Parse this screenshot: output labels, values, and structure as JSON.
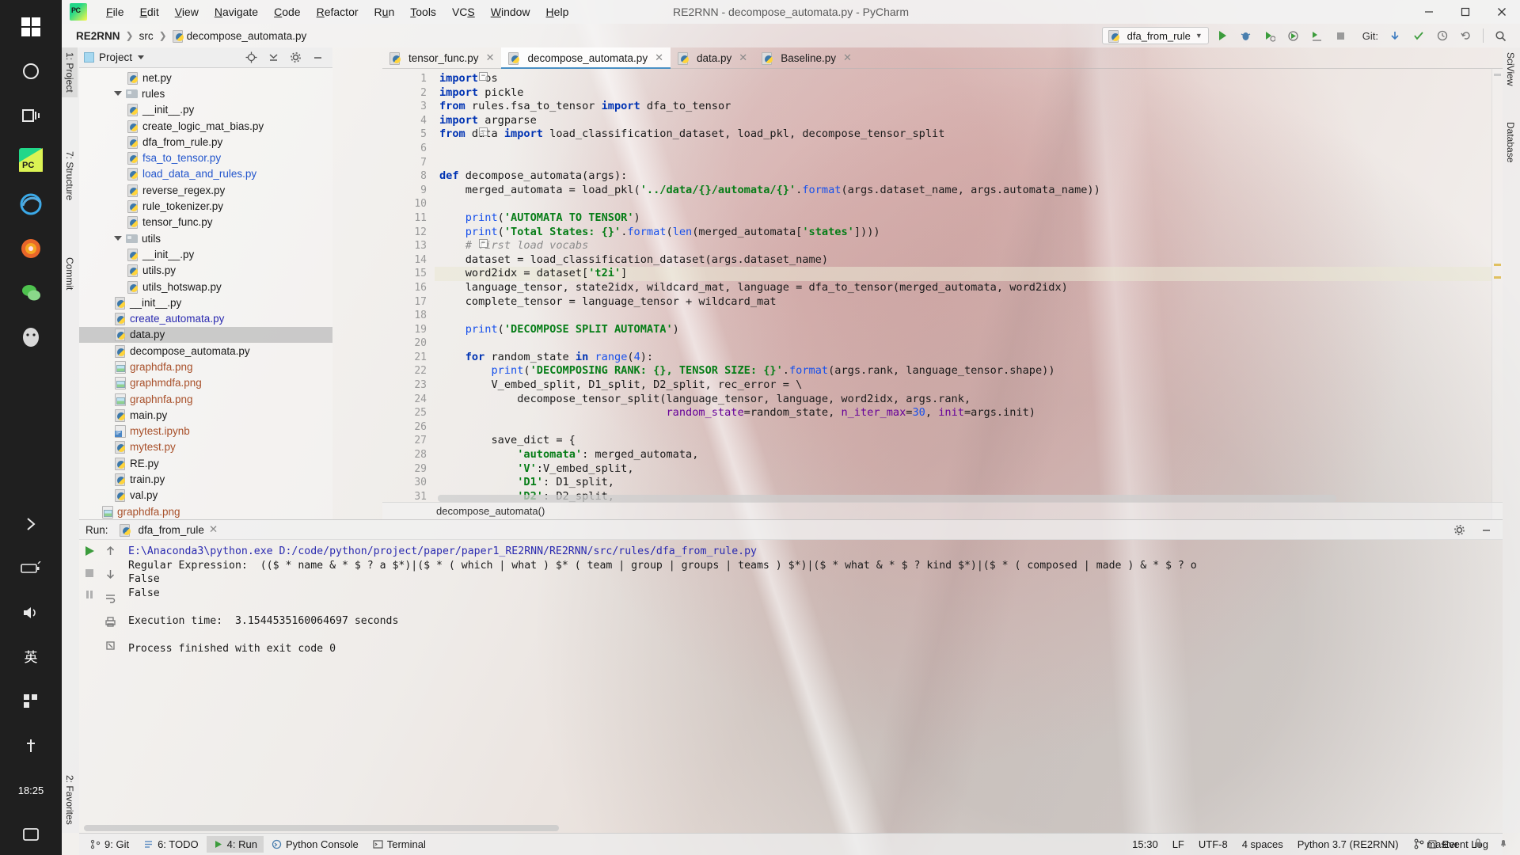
{
  "window": {
    "title": "RE2RNN - decompose_automata.py - PyCharm",
    "app_icon": "pycharm-logo-icon",
    "minimize_label": "—",
    "maximize_label": "□",
    "close_label": "✕"
  },
  "menubar": {
    "items": [
      {
        "label": "File",
        "mnemonic": "F"
      },
      {
        "label": "Edit",
        "mnemonic": "E"
      },
      {
        "label": "View",
        "mnemonic": "V"
      },
      {
        "label": "Navigate",
        "mnemonic": "N"
      },
      {
        "label": "Code",
        "mnemonic": "C"
      },
      {
        "label": "Refactor",
        "mnemonic": "R"
      },
      {
        "label": "Run",
        "mnemonic": "u"
      },
      {
        "label": "Tools",
        "mnemonic": "T"
      },
      {
        "label": "VCS",
        "mnemonic": "S"
      },
      {
        "label": "Window",
        "mnemonic": "W"
      },
      {
        "label": "Help",
        "mnemonic": "H"
      }
    ]
  },
  "breadcrumb": {
    "project": "RE2RNN",
    "folder": "src",
    "file": "decompose_automata.py"
  },
  "toolbar": {
    "run_config": "dfa_from_rule",
    "git_label": "Git:",
    "icons": [
      "run-icon",
      "debug-icon",
      "run-coverage-icon",
      "profile-icon",
      "run-with-console-icon",
      "stop-icon"
    ],
    "git_icons": [
      "update-project-icon",
      "commit-icon",
      "history-icon",
      "rollback-icon"
    ],
    "search_icon": "search-icon"
  },
  "left_strip": {
    "tabs": [
      "1: Project",
      "7: Structure",
      "Commit"
    ]
  },
  "right_strip": {
    "tabs": [
      "SciView",
      "Database"
    ]
  },
  "project_panel": {
    "title": "Project",
    "header_icons": [
      "locate-icon",
      "collapse-all-icon",
      "settings-icon",
      "hide-icon"
    ],
    "tree": [
      {
        "label": "net.py",
        "indent": 3,
        "icon": "python-file-icon",
        "color": "default",
        "type": "file"
      },
      {
        "label": "rules",
        "indent": 2,
        "icon": "folder-icon",
        "color": "default",
        "type": "folder",
        "expanded": true
      },
      {
        "label": "__init__.py",
        "indent": 3,
        "icon": "python-file-icon",
        "color": "default",
        "type": "file"
      },
      {
        "label": "create_logic_mat_bias.py",
        "indent": 3,
        "icon": "python-file-icon",
        "color": "default",
        "type": "file"
      },
      {
        "label": "dfa_from_rule.py",
        "indent": 3,
        "icon": "python-file-icon",
        "color": "default",
        "type": "file"
      },
      {
        "label": "fsa_to_tensor.py",
        "indent": 3,
        "icon": "python-file-icon",
        "color": "link",
        "type": "file"
      },
      {
        "label": "load_data_and_rules.py",
        "indent": 3,
        "icon": "python-file-icon",
        "color": "link",
        "type": "file"
      },
      {
        "label": "reverse_regex.py",
        "indent": 3,
        "icon": "python-file-icon",
        "color": "default",
        "type": "file"
      },
      {
        "label": "rule_tokenizer.py",
        "indent": 3,
        "icon": "python-file-icon",
        "color": "default",
        "type": "file"
      },
      {
        "label": "tensor_func.py",
        "indent": 3,
        "icon": "python-file-icon",
        "color": "default",
        "type": "file"
      },
      {
        "label": "utils",
        "indent": 2,
        "icon": "folder-icon",
        "color": "default",
        "type": "folder",
        "expanded": true
      },
      {
        "label": "__init__.py",
        "indent": 3,
        "icon": "python-file-icon",
        "color": "default",
        "type": "file"
      },
      {
        "label": "utils.py",
        "indent": 3,
        "icon": "python-file-icon",
        "color": "default",
        "type": "file"
      },
      {
        "label": "utils_hotswap.py",
        "indent": 3,
        "icon": "python-file-icon",
        "color": "default",
        "type": "file"
      },
      {
        "label": "__init__.py",
        "indent": 2,
        "icon": "python-file-icon",
        "color": "default",
        "type": "file"
      },
      {
        "label": "create_automata.py",
        "indent": 2,
        "icon": "python-file-icon",
        "color": "blue",
        "type": "file"
      },
      {
        "label": "data.py",
        "indent": 2,
        "icon": "python-file-icon",
        "color": "default",
        "type": "file",
        "selected": true
      },
      {
        "label": "decompose_automata.py",
        "indent": 2,
        "icon": "python-file-icon",
        "color": "default",
        "type": "file"
      },
      {
        "label": "graphdfa.png",
        "indent": 2,
        "icon": "image-file-icon",
        "color": "orange",
        "type": "file"
      },
      {
        "label": "graphmdfa.png",
        "indent": 2,
        "icon": "image-file-icon",
        "color": "orange",
        "type": "file"
      },
      {
        "label": "graphnfa.png",
        "indent": 2,
        "icon": "image-file-icon",
        "color": "orange",
        "type": "file"
      },
      {
        "label": "main.py",
        "indent": 2,
        "icon": "python-file-icon",
        "color": "default",
        "type": "file"
      },
      {
        "label": "mytest.ipynb",
        "indent": 2,
        "icon": "jupyter-file-icon",
        "color": "orange",
        "type": "file"
      },
      {
        "label": "mytest.py",
        "indent": 2,
        "icon": "python-file-icon",
        "color": "orange",
        "type": "file"
      },
      {
        "label": "RE.py",
        "indent": 2,
        "icon": "python-file-icon",
        "color": "default",
        "type": "file"
      },
      {
        "label": "train.py",
        "indent": 2,
        "icon": "python-file-icon",
        "color": "default",
        "type": "file"
      },
      {
        "label": "val.py",
        "indent": 2,
        "icon": "python-file-icon",
        "color": "default",
        "type": "file"
      },
      {
        "label": "graphdfa.png",
        "indent": 1,
        "icon": "image-file-icon",
        "color": "orange",
        "type": "file"
      }
    ]
  },
  "editor": {
    "tabs": [
      {
        "label": "tensor_func.py",
        "active": false,
        "icon": "python-file-icon"
      },
      {
        "label": "decompose_automata.py",
        "active": true,
        "icon": "python-file-icon"
      },
      {
        "label": "data.py",
        "active": false,
        "icon": "python-file-icon"
      },
      {
        "label": "Baseline.py",
        "active": false,
        "icon": "python-file-icon"
      }
    ],
    "breadcrumb": "decompose_automata()",
    "first_line": 1,
    "highlighted_line": 15,
    "lines": [
      {
        "n": 1,
        "text": "import os"
      },
      {
        "n": 2,
        "text": "import pickle"
      },
      {
        "n": 3,
        "text": "from rules.fsa_to_tensor import dfa_to_tensor"
      },
      {
        "n": 4,
        "text": "import argparse"
      },
      {
        "n": 5,
        "text": "from data import load_classification_dataset, load_pkl, decompose_tensor_split"
      },
      {
        "n": 6,
        "text": ""
      },
      {
        "n": 7,
        "text": ""
      },
      {
        "n": 8,
        "text": "def decompose_automata(args):"
      },
      {
        "n": 9,
        "text": "    merged_automata = load_pkl('../data/{}/automata/{}'.format(args.dataset_name, args.automata_name))"
      },
      {
        "n": 10,
        "text": ""
      },
      {
        "n": 11,
        "text": "    print('AUTOMATA TO TENSOR')"
      },
      {
        "n": 12,
        "text": "    print('Total States: {}'.format(len(merged_automata['states'])))"
      },
      {
        "n": 13,
        "text": "    # first load vocabs"
      },
      {
        "n": 14,
        "text": "    dataset = load_classification_dataset(args.dataset_name)"
      },
      {
        "n": 15,
        "text": "    word2idx = dataset['t2i']"
      },
      {
        "n": 16,
        "text": "    language_tensor, state2idx, wildcard_mat, language = dfa_to_tensor(merged_automata, word2idx)"
      },
      {
        "n": 17,
        "text": "    complete_tensor = language_tensor + wildcard_mat"
      },
      {
        "n": 18,
        "text": ""
      },
      {
        "n": 19,
        "text": "    print('DECOMPOSE SPLIT AUTOMATA')"
      },
      {
        "n": 20,
        "text": ""
      },
      {
        "n": 21,
        "text": "    for random_state in range(4):"
      },
      {
        "n": 22,
        "text": "        print('DECOMPOSING RANK: {}, TENSOR SIZE: {}'.format(args.rank, language_tensor.shape))"
      },
      {
        "n": 23,
        "text": "        V_embed_split, D1_split, D2_split, rec_error = \\"
      },
      {
        "n": 24,
        "text": "            decompose_tensor_split(language_tensor, language, word2idx, args.rank,"
      },
      {
        "n": 25,
        "text": "                                   random_state=random_state, n_iter_max=30, init=args.init)"
      },
      {
        "n": 26,
        "text": ""
      },
      {
        "n": 27,
        "text": "        save_dict = {"
      },
      {
        "n": 28,
        "text": "            'automata': merged_automata,"
      },
      {
        "n": 29,
        "text": "            'V':V_embed_split,"
      },
      {
        "n": 30,
        "text": "            'D1': D1_split,"
      },
      {
        "n": 31,
        "text": "            'D2': D2_split,"
      }
    ]
  },
  "run_panel": {
    "label": "Run:",
    "tab": "dfa_from_rule",
    "settings_icon": "gear-icon",
    "minimize_icon": "minimize-icon",
    "action_icons": [
      "rerun-icon",
      "stop-icon",
      "resume-icon"
    ],
    "side_icons": [
      "scroll-up-icon",
      "scroll-down-icon",
      "soft-wrap-icon",
      "print-icon",
      "clear-all-icon"
    ],
    "console": [
      {
        "text": "E:\\Anaconda3\\python.exe D:/code/python/project/paper/paper1_RE2RNN/RE2RNN/src/rules/dfa_from_rule.py",
        "style": "link"
      },
      {
        "text": "Regular Expression:  (($ * name & * $ ? a $*)|($ * ( which | what ) $* ( team | group | groups | teams ) $*)|($ * what & * $ ? kind $*)|($ * ( composed | made ) & * $ ? o",
        "style": "plain"
      },
      {
        "text": "False",
        "style": "plain"
      },
      {
        "text": "False",
        "style": "plain"
      },
      {
        "text": "",
        "style": "plain"
      },
      {
        "text": "Execution time:  3.1544535160064697 seconds",
        "style": "plain"
      },
      {
        "text": "",
        "style": "plain"
      },
      {
        "text": "Process finished with exit code 0",
        "style": "plain"
      }
    ]
  },
  "bottom_bar": {
    "items": [
      {
        "label": "9: Git",
        "icon": "git-icon",
        "selected": false
      },
      {
        "label": "6: TODO",
        "icon": "todo-icon",
        "selected": false
      },
      {
        "label": "4: Run",
        "icon": "run-icon",
        "selected": true
      },
      {
        "label": "Python Console",
        "icon": "python-console-icon",
        "selected": false
      },
      {
        "label": "Terminal",
        "icon": "terminal-icon",
        "selected": false
      }
    ],
    "event_log": "Event Log",
    "event_log_icon": "event-log-icon"
  },
  "status_bar": {
    "time": "15:30",
    "line_separator": "LF",
    "encoding": "UTF-8",
    "indent": "4 spaces",
    "interpreter": "Python 3.7 (RE2RNN)",
    "branch": "master",
    "branch_icon": "git-branch-icon",
    "lock_icon": "lock-icon",
    "notification_icon": "notification-icon"
  },
  "taskbar": {
    "clock": "18:25",
    "ime": "英",
    "icons": [
      "windows-start-icon",
      "search-circle-icon",
      "task-view-icon",
      "pycharm-app-icon",
      "edge-app-icon",
      "firefox-app-icon",
      "wechat-app-icon",
      "qq-app-icon"
    ],
    "tray_icons": [
      "chevron-right-icon",
      "battery-icon",
      "wifi-icon",
      "volume-icon",
      "notification-center-icon"
    ]
  }
}
